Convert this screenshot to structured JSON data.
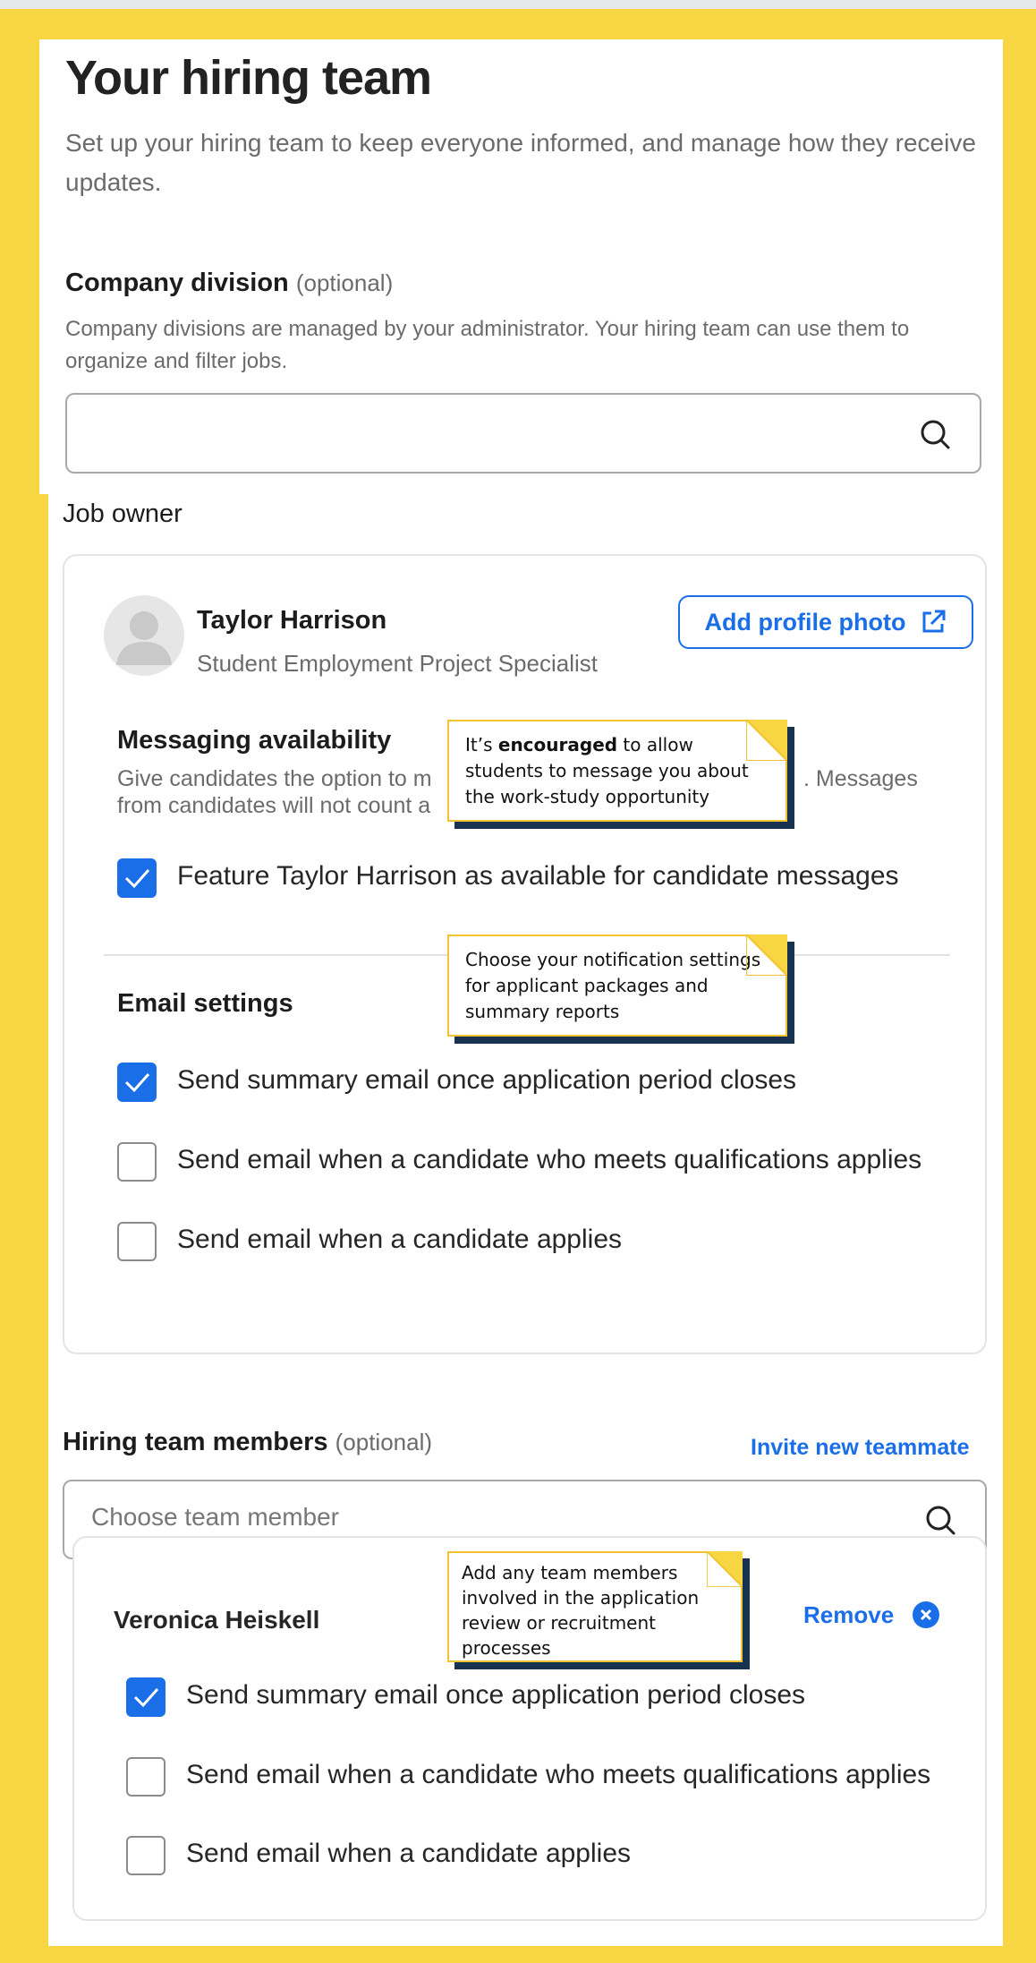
{
  "page": {
    "title": "Your hiring team",
    "subtitle": "Set up your hiring team to keep everyone informed, and manage how they receive updates."
  },
  "company_division": {
    "label": "Company division",
    "optional": "(optional)",
    "help": "Company divisions are managed by your administrator. Your hiring team can use them to organize and filter jobs.",
    "value": ""
  },
  "job_owner": {
    "label": "Job owner",
    "name": "Taylor Harrison",
    "role": "Student Employment Project Specialist",
    "add_photo_label": "Add profile photo",
    "messaging": {
      "title": "Messaging availability",
      "help_line1": "Give candidates the option to m",
      "help_line1_end": ". Messages",
      "help_line2": "from candidates will not count a",
      "checkbox_label": "Feature Taylor Harrison as available for candidate messages",
      "checked": true
    },
    "email": {
      "title": "Email settings",
      "options": [
        {
          "label": "Send summary email once application period closes",
          "checked": true
        },
        {
          "label": "Send email when a candidate who meets qualifications applies",
          "checked": false
        },
        {
          "label": "Send email when a candidate applies",
          "checked": false
        }
      ]
    }
  },
  "hiring_team": {
    "label": "Hiring team members",
    "optional": "(optional)",
    "invite_label": "Invite new teammate",
    "search_placeholder": "Choose team member",
    "member": {
      "name": "Veronica Heiskell",
      "remove_label": "Remove",
      "options": [
        {
          "label": "Send summary email once application period closes",
          "checked": true
        },
        {
          "label": "Send email when a candidate who meets qualifications applies",
          "checked": false
        },
        {
          "label": "Send email when a candidate applies",
          "checked": false
        }
      ]
    }
  },
  "annotations": {
    "messaging_note_pre": "It’s ",
    "messaging_note_bold": "encouraged",
    "messaging_note_post": " to allow students to message you about the work-study opportunity",
    "email_note": "Choose your notification settings for applicant packages and summary reports",
    "team_note": "Add any team members involved in the application review or recruitment processes"
  },
  "colors": {
    "accent": "#1a6ee8",
    "frame": "#f8d542",
    "note_border": "#f2c230",
    "note_shadow": "#17324f"
  }
}
